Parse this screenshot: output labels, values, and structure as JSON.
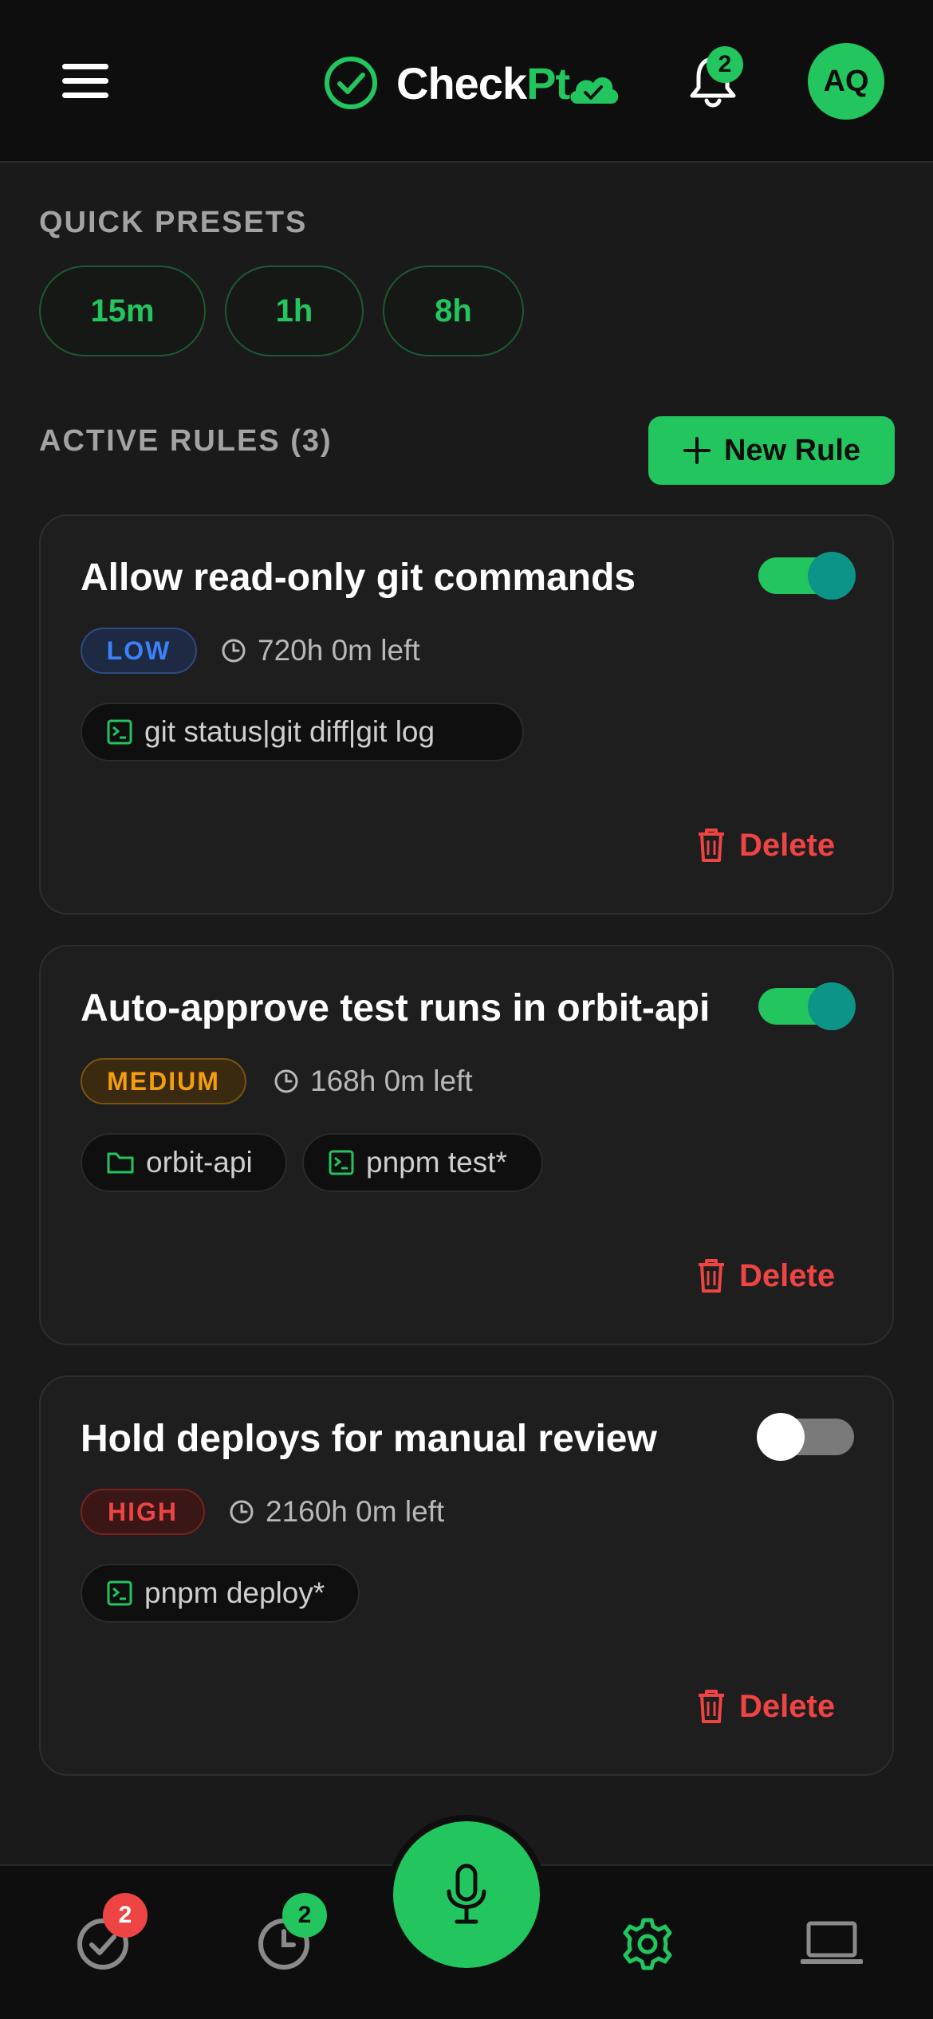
{
  "header": {
    "brand_prefix": "Check",
    "brand_suffix": "Pt",
    "notifications_count": "2",
    "avatar_initials": "AQ"
  },
  "presets": {
    "title": "QUICK PRESETS",
    "items": [
      "15m",
      "1h",
      "8h"
    ]
  },
  "rules": {
    "title": "ACTIVE RULES (3)",
    "new_rule_label": "New Rule",
    "delete_label": "Delete",
    "items": [
      {
        "title": "Allow read-only git commands",
        "enabled": true,
        "level": "LOW",
        "time_left": "720h 0m left",
        "chips": [
          {
            "icon": "terminal-icon",
            "text": "git status|git diff|git log"
          }
        ]
      },
      {
        "title": "Auto-approve test runs in orbit-api",
        "enabled": true,
        "level": "MEDIUM",
        "time_left": "168h 0m left",
        "chips": [
          {
            "icon": "folder-icon",
            "text": "orbit-api"
          },
          {
            "icon": "terminal-icon",
            "text": "pnpm test*"
          }
        ]
      },
      {
        "title": "Hold deploys for manual review",
        "enabled": false,
        "level": "HIGH",
        "time_left": "2160h 0m left",
        "chips": [
          {
            "icon": "terminal-icon",
            "text": "pnpm deploy*"
          }
        ]
      }
    ]
  },
  "bottom_nav": {
    "approvals_badge": "2",
    "history_badge": "2"
  },
  "colors": {
    "accent": "#22c55e",
    "danger": "#ef4444",
    "low": "#3b82f6",
    "medium": "#f59e0b",
    "high": "#ef4444",
    "toggle_knob_on": "#0d9488"
  }
}
